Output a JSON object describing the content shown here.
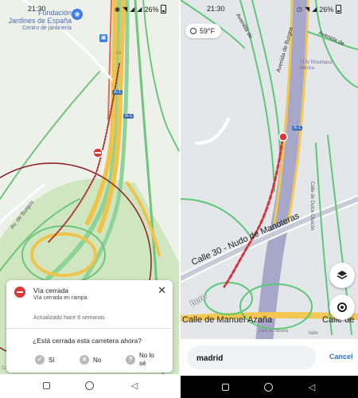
{
  "left": {
    "status_time": "21:30",
    "battery": "26%",
    "poi_name": "Fundación\nJardines de España",
    "poi_category": "Centro de jardinería",
    "road_A1": "A-1",
    "road_A1b": "A-1",
    "road_1A": "1A",
    "street_burgos": "Av. de Burgos",
    "card": {
      "title": "Vía cerrada",
      "subtitle": "Vía cerrada en rampa",
      "updated": "Actualizado hace 6 semanas",
      "question": "¿Está cerrada esta carretera ahora?",
      "option_yes": "Sí",
      "option_no": "No",
      "option_unsure": "No lo sé"
    },
    "watermark": "Datos"
  },
  "right": {
    "status_time": "21:30",
    "battery": "26%",
    "weather": "59°F",
    "street_avenida_burgos": "Avenida de Burgos",
    "street_avenida_de": "Avenida de",
    "poi_tuv": "TÜV Rheinland\nIbérica",
    "street_dulce_chacon": "Calle de Dulce Chacón",
    "road_A1": "A-1",
    "street_calle30": "Calle 30 - Nudo de Manoteras",
    "street_manuel_azana": "Calle de Manuel Azaña",
    "street_calle_de": "Calle de",
    "street_tabueta": "Calle de Tabueta",
    "street_valle": "Valle",
    "here_logo": "here",
    "search_value": "madrid",
    "cancel_label": "Cancel"
  }
}
